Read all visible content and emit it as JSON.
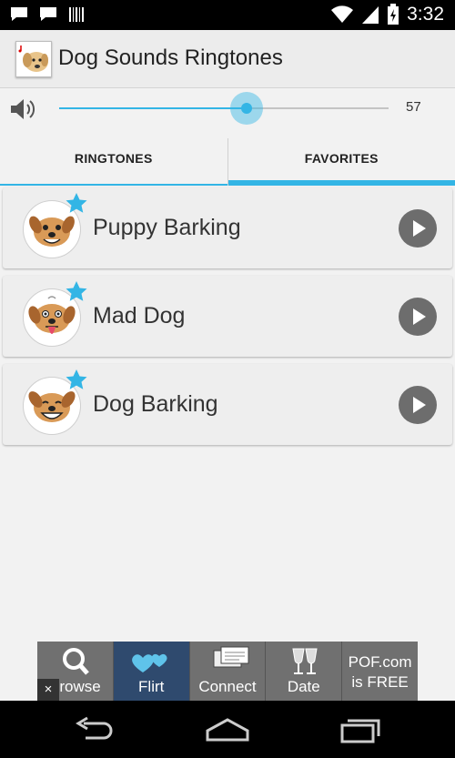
{
  "status_bar": {
    "time": "3:32",
    "left_icons": [
      "chat-bubble-icon",
      "chat-bubble-icon",
      "barcode-icon"
    ],
    "right_icons": [
      "wifi-icon",
      "signal-icon",
      "battery-charging-icon"
    ]
  },
  "app": {
    "title": "Dog Sounds Ringtones",
    "icon": "app-dog-icon"
  },
  "volume": {
    "icon": "speaker-icon",
    "level": 57,
    "max": 100,
    "value_label": "57"
  },
  "tabs": [
    {
      "label": "RINGTONES",
      "selected": false
    },
    {
      "label": "FAVORITES",
      "selected": true
    }
  ],
  "sounds": [
    {
      "label": "Puppy Barking",
      "favorite": true,
      "avatar": "puppy-face-icon",
      "action_icon": "play-icon"
    },
    {
      "label": "Mad Dog",
      "favorite": true,
      "avatar": "mad-dog-face-icon",
      "action_icon": "play-icon"
    },
    {
      "label": "Dog Barking",
      "favorite": true,
      "avatar": "barking-dog-face-icon",
      "action_icon": "play-icon"
    }
  ],
  "ad_banner": {
    "items": [
      {
        "label": "Browse",
        "icon": "magnifier-icon"
      },
      {
        "label": "Flirt",
        "icon": "hearts-icon"
      },
      {
        "label": "Connect",
        "icon": "messages-icon"
      },
      {
        "label": "Date",
        "icon": "wine-glasses-icon"
      }
    ],
    "promo_line1": "POF.com",
    "promo_line2": "is FREE",
    "close_label": "×"
  },
  "nav_bar": [
    "back-icon",
    "home-icon",
    "recents-icon"
  ],
  "colors": {
    "accent": "#33b5e5",
    "action_bar": "#ececec",
    "background": "#f2f2f2",
    "play_button": "#6d6d6d"
  }
}
